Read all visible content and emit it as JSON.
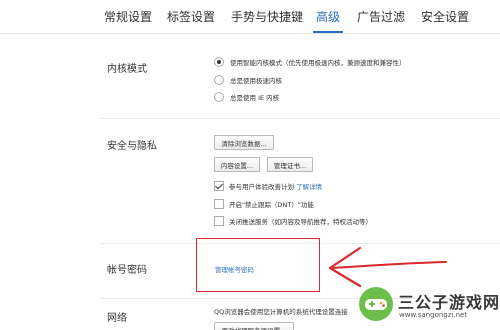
{
  "tabs": [
    {
      "label": "常规设置"
    },
    {
      "label": "标签设置"
    },
    {
      "label": "手势与快捷键"
    },
    {
      "label": "高级",
      "active": true
    },
    {
      "label": "广告过滤"
    },
    {
      "label": "安全设置"
    }
  ],
  "kernel": {
    "label": "内核模式",
    "options": [
      {
        "label": "使用智能内核模式（优先使用极速内核，兼顾速度和兼容性）",
        "checked": true
      },
      {
        "label": "总是使用极速内核",
        "checked": false
      },
      {
        "label": "总是使用 IE 内核",
        "checked": false
      }
    ]
  },
  "privacy": {
    "label": "安全与隐私",
    "clear_button": "清除浏览数据...",
    "content_button": "内容设置...",
    "cert_button": "管理证书...",
    "checks": [
      {
        "label": "参与用户体验改善计划",
        "link": "了解详情",
        "checked": true
      },
      {
        "label": "开启\"禁止跟踪（DNT）\"功能",
        "checked": false
      },
      {
        "label": "关闭推送服务（如内容及导航推荐，特权活动等）",
        "checked": false
      }
    ]
  },
  "account": {
    "label": "帐号密码",
    "manage_link": "管理帐号密码"
  },
  "network": {
    "label": "网络",
    "description": "QQ浏览器会使用您计算机的系统代理设置连接",
    "proxy_button": "更改代理服务器设置..."
  },
  "watermark": {
    "title": "三公子游戏网",
    "url": "www.sangongzi.net"
  },
  "colors": {
    "accent": "#2a6fbe",
    "annotation_red": "#d9292d"
  }
}
